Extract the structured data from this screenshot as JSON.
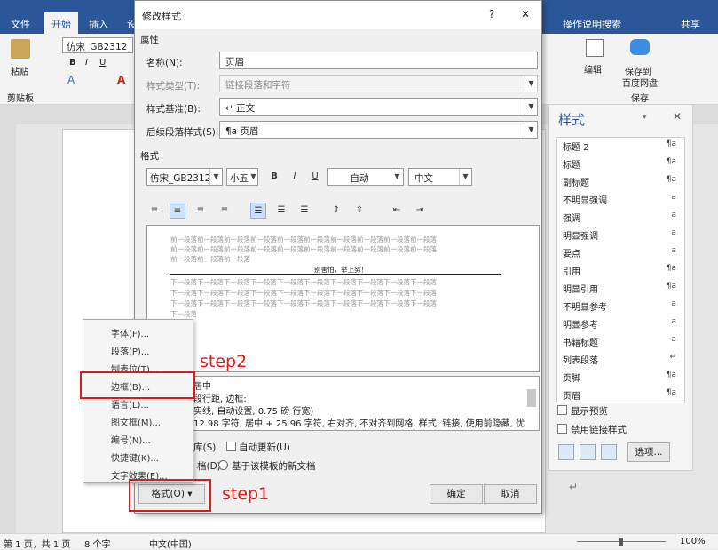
{
  "app": {
    "tabs": [
      "文件",
      "开始",
      "插入"
    ],
    "tab_partial": "设",
    "right_tab": "操作说明搜索",
    "share": "共享",
    "font_name": "仿宋_GB2312",
    "paste_label": "粘贴",
    "clipboard_label": "剪贴板",
    "edit_label": "编辑",
    "save_label": "保存到",
    "save_label2": "百度网盘",
    "save_group": "保存",
    "ribbon_icons": [
      "B",
      "I",
      "U",
      "A"
    ]
  },
  "status": {
    "page": "第 1 页，共 1 页",
    "words": "8 个字",
    "lang": "中文(中国)",
    "zoom": "100%"
  },
  "styles_pane": {
    "title": "样式",
    "items": [
      {
        "name": "标题 2",
        "mark": "¶a"
      },
      {
        "name": "标题",
        "mark": "¶a"
      },
      {
        "name": "副标题",
        "mark": "¶a"
      },
      {
        "name": "不明显强调",
        "mark": "a"
      },
      {
        "name": "强调",
        "mark": "a"
      },
      {
        "name": "明显强调",
        "mark": "a"
      },
      {
        "name": "要点",
        "mark": "a"
      },
      {
        "name": "引用",
        "mark": "¶a"
      },
      {
        "name": "明显引用",
        "mark": "¶a"
      },
      {
        "name": "不明显参考",
        "mark": "a"
      },
      {
        "name": "明显参考",
        "mark": "a"
      },
      {
        "name": "书籍标题",
        "mark": "a"
      },
      {
        "name": "列表段落",
        "mark": "↵"
      },
      {
        "name": "页脚",
        "mark": "¶a"
      },
      {
        "name": "页眉",
        "mark": "¶a"
      }
    ],
    "show_preview": "显示预览",
    "disable_linked": "禁用链接样式",
    "options": "选项..."
  },
  "dialog": {
    "title": "修改样式",
    "help": "?",
    "close": "✕",
    "section_props": "属性",
    "name_label": "名称(N):",
    "name_value": "页眉",
    "type_label": "样式类型(T):",
    "type_value": "链接段落和字符",
    "based_label": "样式基准(B):",
    "based_value": "↵ 正文",
    "next_label": "后续段落样式(S):",
    "next_value": "¶a 页眉",
    "section_format": "格式",
    "font": "仿宋_GB2312",
    "size": "小五",
    "bold": "B",
    "italic": "I",
    "underline": "U",
    "color": "自动",
    "script": "中文",
    "preview_prev": "前一段落前一段落前一段落前一段落前一段落前一段落前一段落前一段落前一段落前一段落",
    "preview_prev_short": "前一段落前一段落前一段落",
    "preview_sample": "别害怕，举上努！",
    "preview_next": "下一段落下一段落下一段落下一段落下一段落下一段落下一段落下一段落下一段落下一段落",
    "preview_next_short": "下一段落",
    "desc_line1": "居中",
    "desc_line2": "段行距, 边框:",
    "desc_line3": "实线, 自动设置,  0.75 磅 行宽)",
    "desc_line4": "12.98 字符, 居中 +  25.96 字符, 右对齐, 不对齐到网格, 样式: 链接, 使用前隐藏, 优",
    "add_to_gallery": "库(S)",
    "auto_update": "自动更新(U)",
    "only_doc": "档(D)",
    "new_doc": "基于该模板的新文档",
    "format_btn": "格式(O) ▾",
    "ok": "确定",
    "cancel": "取消"
  },
  "format_menu": {
    "items": [
      "字体(F)...",
      "段落(P)...",
      "制表位(T)...",
      "边框(B)...",
      "语言(L)...",
      "图文框(M)...",
      "编号(N)...",
      "快捷键(K)...",
      "文字效果(E)..."
    ]
  },
  "annotations": {
    "step1": "step1",
    "step2": "step2"
  }
}
